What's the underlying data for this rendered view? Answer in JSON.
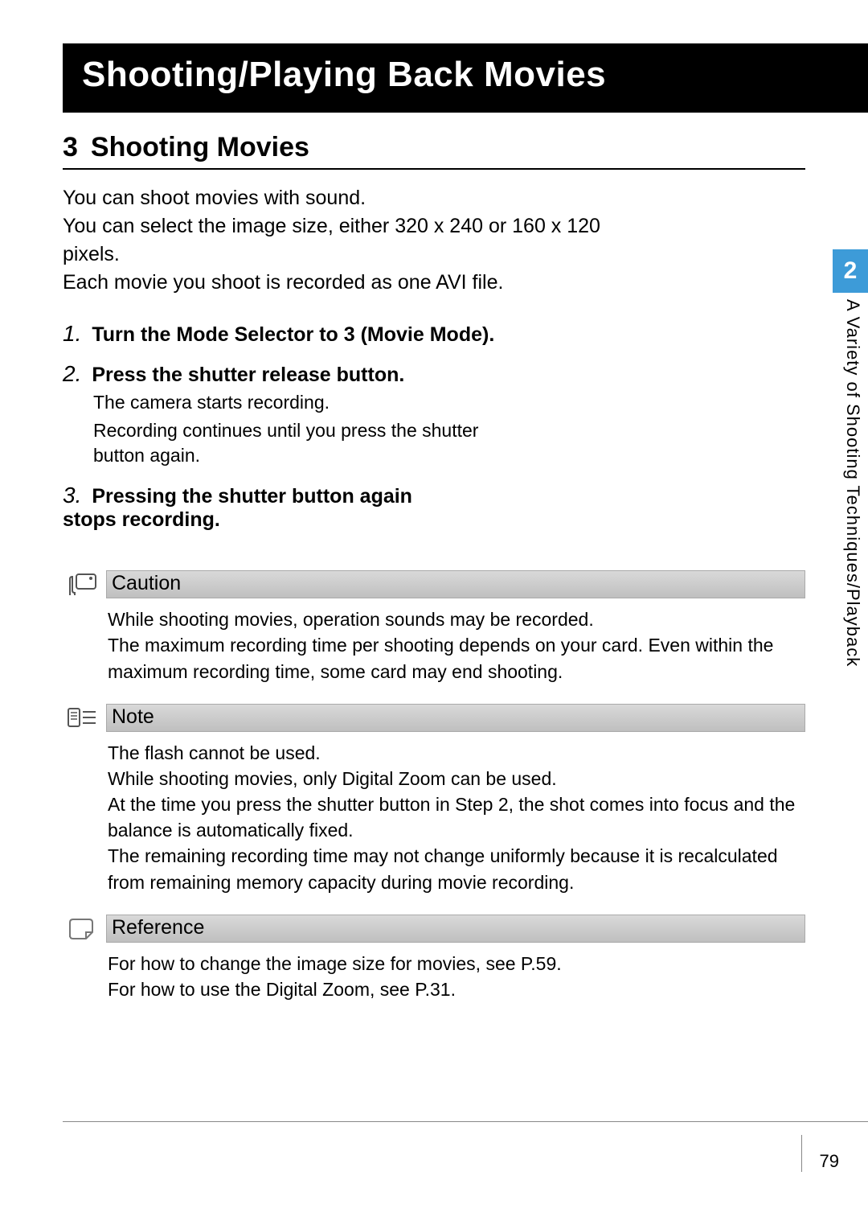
{
  "chapter_banner": "Shooting/Playing Back Movies",
  "section": {
    "number_icon": "3",
    "title": "Shooting Movies"
  },
  "intro_lines": [
    "You can shoot movies with sound.",
    "You can select the image size, either 320 x 240 or 160 x 120 pixels.",
    "Each movie you shoot is recorded as one AVI file."
  ],
  "steps": [
    {
      "num": "1.",
      "head": "Turn the Mode Selector to 3   (Movie Mode).",
      "sub": []
    },
    {
      "num": "2.",
      "head": "Press the shutter release button.",
      "sub": [
        "The camera starts recording.",
        "Recording continues until you press the shutter button again."
      ]
    },
    {
      "num": "3.",
      "head": "Pressing the shutter button again stops recording.",
      "sub": []
    }
  ],
  "caution": {
    "title": "Caution",
    "body": "While shooting movies, operation sounds may be recorded.\nThe maximum recording time per shooting depends on your card. Even within the maximum recording time, some card may end shooting."
  },
  "note": {
    "title": "Note",
    "body": "The flash cannot be used.\nWhile shooting movies, only Digital Zoom can be used.\nAt the time you press the shutter button in Step 2, the shot comes into focus and the balance is automatically fixed.\nThe remaining recording time may not change uniformly because it is recalculated from remaining memory capacity during movie recording."
  },
  "reference": {
    "title": "Reference",
    "body": "For how to change the image size for movies, see P.59.\nFor how to use the Digital Zoom, see P.31."
  },
  "chapter_tab": "2",
  "side_label": "A Variety of Shooting Techniques/Playback",
  "page_number": "79"
}
